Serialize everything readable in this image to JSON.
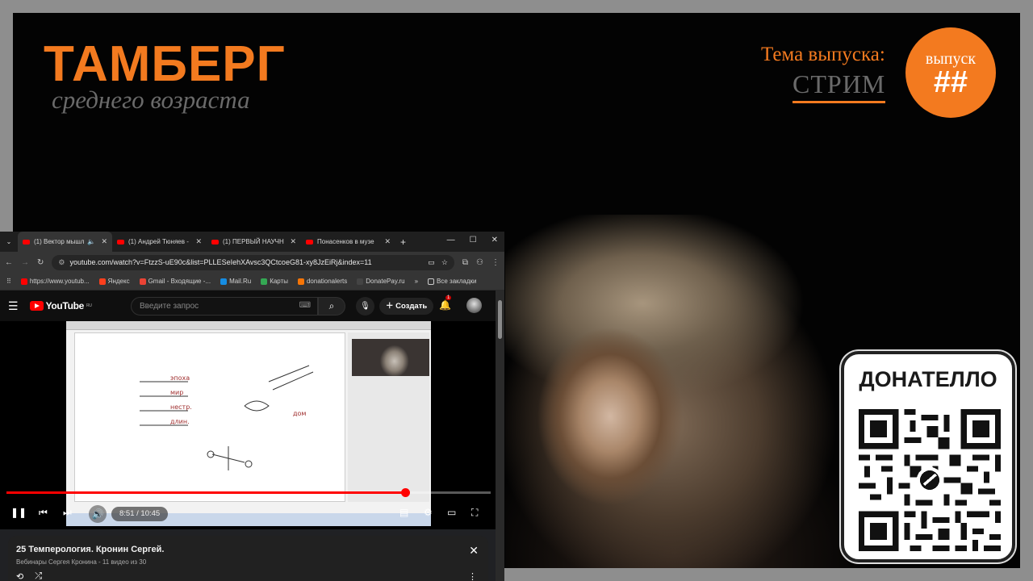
{
  "overlay": {
    "logo_title": "ТАМБЕРГ",
    "logo_subtitle": "среднего возраста",
    "topic_label": "Тема выпуска:",
    "topic_value": "СТРИМ",
    "issue_label": "выпуск",
    "issue_number": "##",
    "donate_title": "ДОНАТЕЛЛО",
    "colors": {
      "accent": "#f37a1f",
      "gray_text": "#6a6a6a"
    }
  },
  "browser": {
    "tabs": [
      {
        "label": "(1) Вектор мышл",
        "active": true,
        "muted_icon": "🔈"
      },
      {
        "label": "(1) Андрей Тюняев -",
        "active": false
      },
      {
        "label": "(1) ПЕРВЫЙ НАУЧН",
        "active": false
      },
      {
        "label": "Понасенков в музе",
        "active": false
      }
    ],
    "new_tab": "+",
    "window_controls": {
      "minimize": "—",
      "maximize": "☐",
      "close": "✕"
    },
    "url": "youtube.com/watch?v=FtzzS-uE90c&list=PLLESeIehXAvsc3QCtcoeG81-xy8JzEiRj&index=11",
    "bookmarks": [
      {
        "label": "https://www.youtub...",
        "color": "#f00"
      },
      {
        "label": "Яндекс",
        "color": "#fc3f1d"
      },
      {
        "label": "Gmail - Входящие -...",
        "color": "#ea4335"
      },
      {
        "label": "Mail.Ru",
        "color": "#168de2"
      },
      {
        "label": "Карты",
        "color": "#34a853"
      },
      {
        "label": "donationalerts",
        "color": "#f57507"
      },
      {
        "label": "DonatePay.ru",
        "color": "#444"
      }
    ],
    "bookmarks_more": "»",
    "all_bookmarks": "Все закладки"
  },
  "youtube": {
    "logo": "YouTube",
    "logo_region": "RU",
    "search_placeholder": "Введите запрос",
    "create_label": "Создать",
    "notifications_count": "1",
    "player": {
      "time": "8:51 / 10:45",
      "progress": 0.823
    },
    "video": {
      "title": "25 Темперология. Кронин Сергей.",
      "meta": "Вебинары Сергея Кронина - 11 видео из 30"
    }
  }
}
